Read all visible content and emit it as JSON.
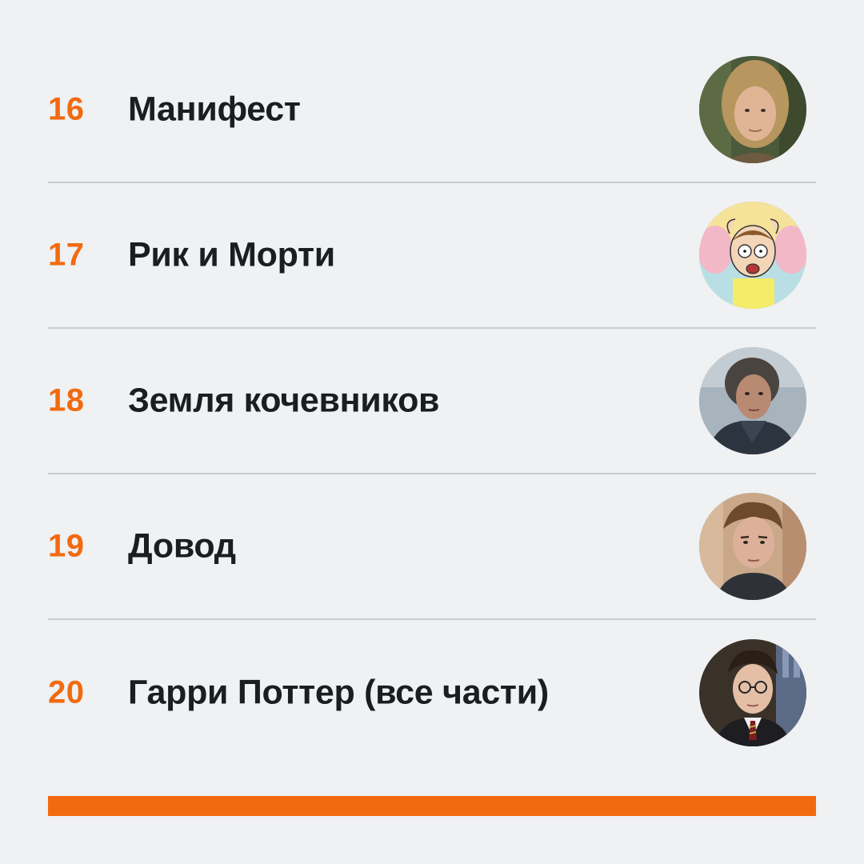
{
  "ranking": {
    "items": [
      {
        "rank": "16",
        "title": "Манифест",
        "thumbnail": "woman-portrait-thumbnail"
      },
      {
        "rank": "17",
        "title": "Рик и Морти",
        "thumbnail": "cartoon-morty-thumbnail"
      },
      {
        "rank": "18",
        "title": "Земля кочевников",
        "thumbnail": "woman-outdoor-portrait-thumbnail"
      },
      {
        "rank": "19",
        "title": "Довод",
        "thumbnail": "man-portrait-thumbnail"
      },
      {
        "rank": "20",
        "title": "Гарри Поттер (все части)",
        "thumbnail": "harry-potter-portrait-thumbnail"
      }
    ]
  },
  "colors": {
    "accent": "#f26a10",
    "text": "#1c1d20",
    "background": "#eff1f3",
    "divider": "#c9ccd1"
  }
}
